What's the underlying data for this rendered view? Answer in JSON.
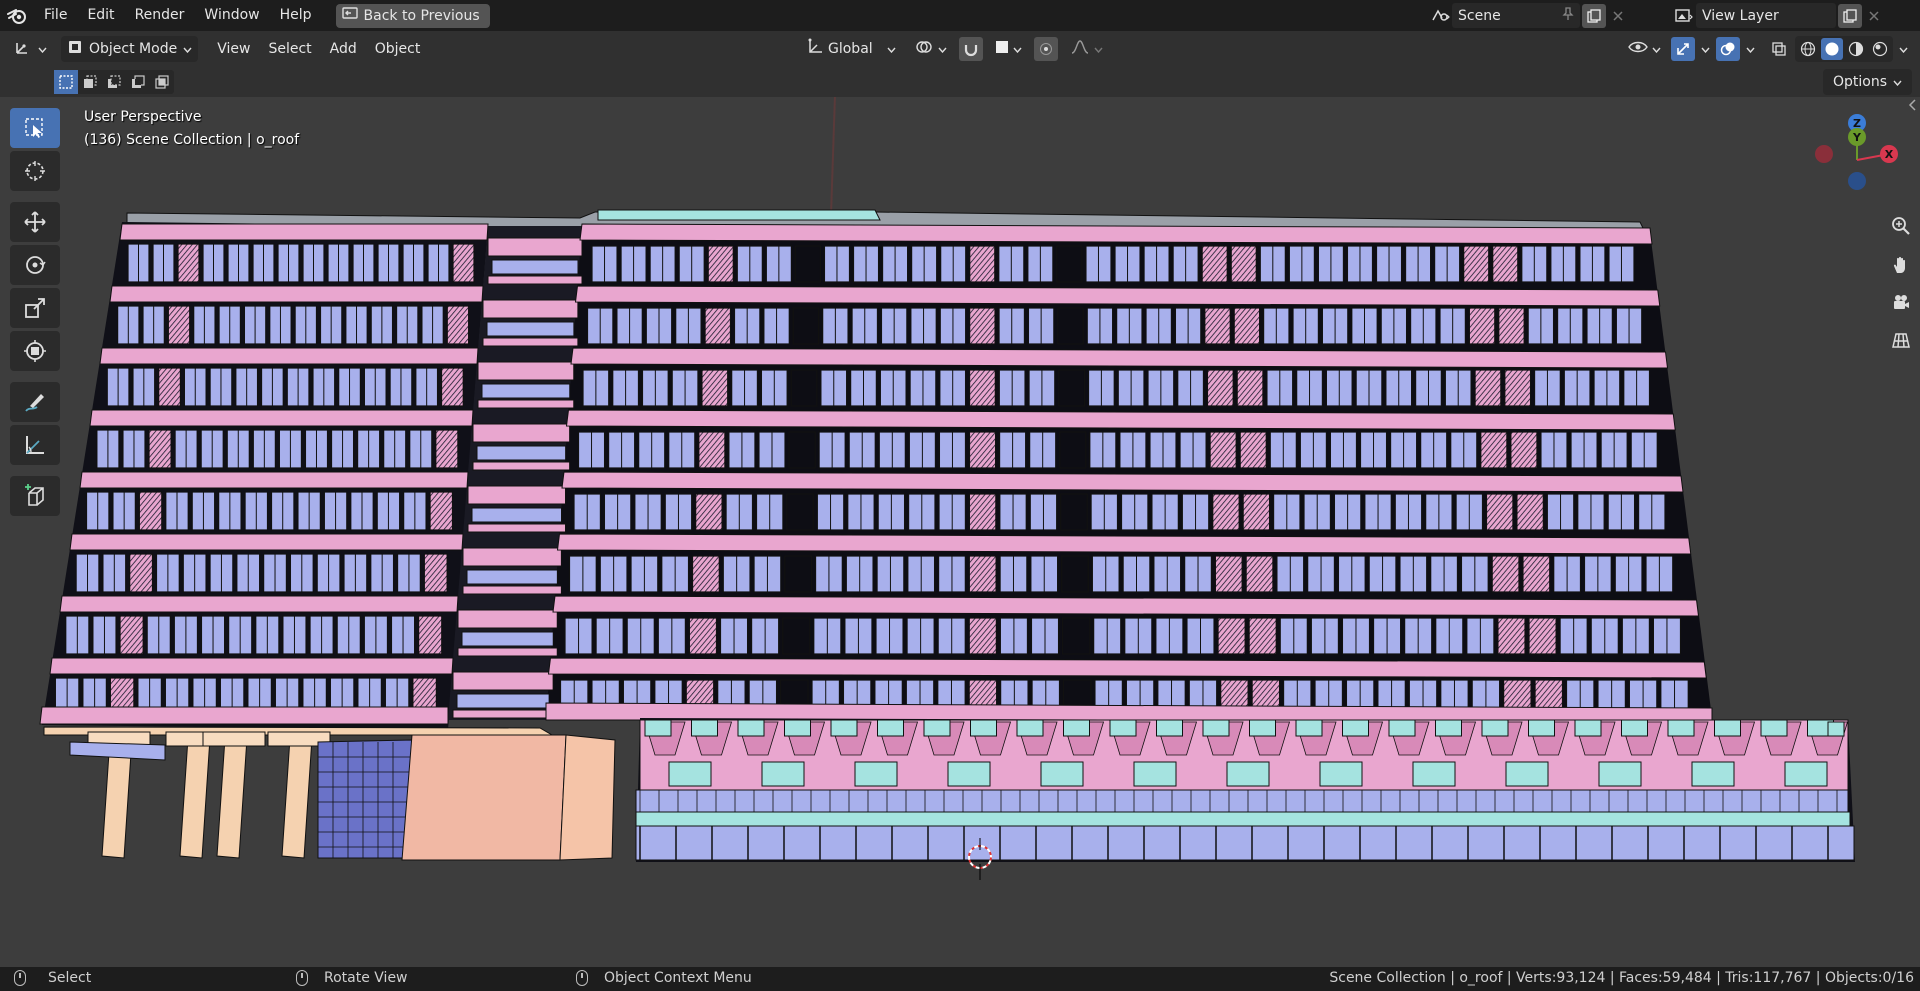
{
  "menubar": {
    "logo": "blender-logo-icon",
    "items": [
      "File",
      "Edit",
      "Render",
      "Window",
      "Help"
    ],
    "back_button": "Back to Previous",
    "scene_label": "Scene",
    "view_layer_label": "View Layer"
  },
  "header": {
    "mode": "Object Mode",
    "menus": [
      "View",
      "Select",
      "Add",
      "Object"
    ],
    "transform_orientation": "Global"
  },
  "subheader": {
    "options_label": "Options"
  },
  "viewport": {
    "perspective": "User Perspective",
    "collection_info": "(136) Scene Collection | o_roof"
  },
  "gizmo": {
    "z_label": "Z",
    "y_label": "Y",
    "x_label": "X"
  },
  "statusbar": {
    "select": "Select",
    "rotate": "Rotate View",
    "context_menu": "Object Context Menu",
    "stats": "Scene Collection | o_roof | Verts:93,124 | Faces:59,484 | Tris:117,767 | Objects:0/16"
  },
  "colors": {
    "accent": "#4772b3",
    "facade_pink": "#e9a6cf",
    "window_blue": "#a8b0ec",
    "pillar": "#f5d2b0",
    "teal": "#a5e3e0"
  }
}
